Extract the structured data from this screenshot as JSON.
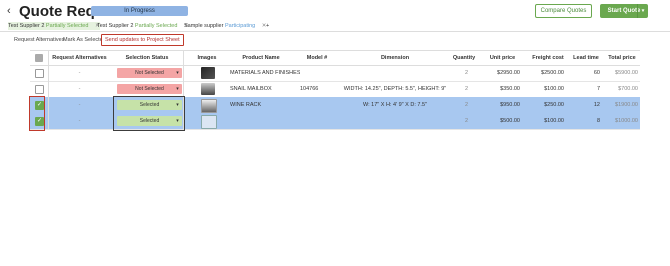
{
  "header": {
    "back_glyph": "‹",
    "title": "Quote Request",
    "status_badge": "In Progress",
    "compare_button": "Compare Quotes",
    "start_button": "Start Quote",
    "start_dropdown": "▾"
  },
  "suppliers": [
    {
      "name": "Test Supplier 2",
      "status": "Partially Selected",
      "close": "✕"
    },
    {
      "name": "Test Supplier 2",
      "status": "Partially Selected",
      "close": "✕"
    },
    {
      "name": "Sample supplier",
      "status": "Participating",
      "close": "✕"
    },
    {
      "name": "+",
      "status": "",
      "close": ""
    }
  ],
  "actions": {
    "request_alternatives": "Request Alternatives",
    "mark_as_selected": "Mark As Selected",
    "send_updates": "Send updates to Project Sheet"
  },
  "columns": [
    "Request Alternatives",
    "Selection Status",
    "Images",
    "Product Name",
    "Model #",
    "Dimension",
    "Quantity",
    "Unit price",
    "Freight cost",
    "Lead time",
    "Total price"
  ],
  "rows": [
    {
      "alt": "-",
      "status": "Not Selected",
      "product": "MATERIALS AND FINISHES",
      "model": "",
      "dimension": "",
      "quantity": "2",
      "unit_price": "$2950.00",
      "freight": "$2500.00",
      "lead": "60",
      "total": "$5900.00",
      "checked": false,
      "selected": false
    },
    {
      "alt": "-",
      "status": "Not Selected",
      "product": "SNAIL MAILBOX",
      "model": "104766",
      "dimension": "WIDTH: 14.25\", DEPTH: 5.5\", HEIGHT: 9\"",
      "quantity": "2",
      "unit_price": "$350.00",
      "freight": "$100.00",
      "lead": "7",
      "total": "$700.00",
      "checked": false,
      "selected": false
    },
    {
      "alt": "-",
      "status": "Selected",
      "product": "WINE RACK",
      "model": "",
      "dimension": "W: 17\" X H: 4' 9\" X D: 7.5\"",
      "quantity": "2",
      "unit_price": "$950.00",
      "freight": "$250.00",
      "lead": "12",
      "total": "$1900.00",
      "checked": true,
      "selected": true
    },
    {
      "alt": "-",
      "status": "Selected",
      "product": "",
      "model": "",
      "dimension": "",
      "quantity": "2",
      "unit_price": "$500.00",
      "freight": "$100.00",
      "lead": "8",
      "total": "$1000.00",
      "checked": true,
      "selected": true
    }
  ],
  "icons": {
    "checkmark": "✓",
    "dropdown": "▾"
  },
  "colors": {
    "accent_green": "#6aa84f",
    "status_blue": "#8fb3e3",
    "not_selected_red": "#f4a5a5",
    "selected_green": "#c6e2a8",
    "row_selected_blue": "#a8c8f0",
    "highlight_red": "#c0392b"
  }
}
